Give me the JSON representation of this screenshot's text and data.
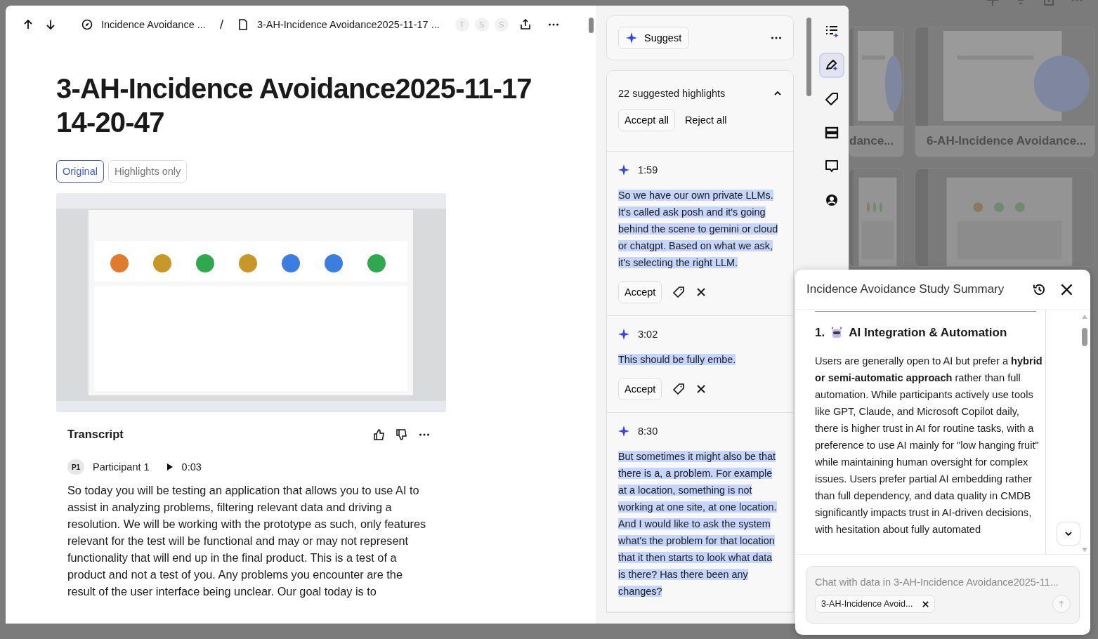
{
  "background": {
    "cards": [
      {
        "title": "dance..."
      },
      {
        "title": "6-AH-Incidence Avoidance..."
      }
    ]
  },
  "toolbar": {
    "breadcrumb": [
      {
        "kind": "project",
        "label": "Incidence Avoidance ..."
      },
      {
        "kind": "document",
        "label": "3-AH-Incidence Avoidance2025-11-17 ..."
      }
    ],
    "separator": "/",
    "avatars": [
      "T",
      "S",
      "S"
    ]
  },
  "document": {
    "title": "3-AH-Incidence Avoidance2025-11-17 14-20-47",
    "view_tabs": [
      {
        "label": "Original",
        "selected": true
      },
      {
        "label": "Highlights only",
        "selected": false
      }
    ],
    "transcript": {
      "heading": "Transcript",
      "speaker_badge": "P1",
      "speaker": "Participant 1",
      "timestamp": "0:03",
      "text": "So today you will be testing an application that allows you to use AI to assist in analyzing problems, filtering relevant data and driving a resolution. We will be working with the prototype as such, only features relevant for the test will be functional and may or may not represent functionality that will end up in the final product. This is a test of a product and not a test of you. Any problems you encounter are the result of the user interface being unclear. Our goal today is to"
    }
  },
  "suggestions": {
    "suggest_button": "Suggest",
    "count_label": "22 suggested highlights",
    "expanded": true,
    "accept_all": "Accept all",
    "reject_all": "Reject all",
    "items": [
      {
        "time": "1:59",
        "quote": "So we have our own private LLMs. It's called ask posh and it's going behind the scene to gemini or cloud or chatgpt. Based on what we ask, it's selecting the right LLM.",
        "accept": "Accept"
      },
      {
        "time": "3:02",
        "quote": "This should be fully embe.",
        "accept": "Accept"
      },
      {
        "time": "8:30",
        "quote": "But sometimes it might also be that there is a, a problem. For example at a location, something is not working at one site, at one location. And I would like to ask the system what's the problem for that location that it then starts to look what data is there? Has there been any changes?"
      }
    ]
  },
  "rail": [
    {
      "selected": false
    },
    {
      "selected": true
    },
    {
      "selected": false
    },
    {
      "selected": false
    },
    {
      "selected": false
    },
    {
      "selected": false
    }
  ],
  "summary": {
    "title": "Incidence Avoidance Study Summary",
    "section_number": "1.",
    "section_title": "AI Integration & Automation",
    "body": "Users are generally open to AI but prefer a **hybrid or semi-automatic approach** rather than full automation. While participants actively use tools like GPT, Claude, and Microsoft Copilot daily, there is higher trust in AI for routine tasks, with a preference to use AI mainly for \"low hanging fruit\" while maintaining human oversight for complex issues. Users prefer partial AI embedding rather than full dependency, and data quality in CMDB significantly impacts trust in AI-driven decisions, with hesitation about fully automated",
    "chat_placeholder": "Chat with data in 3-AH-Incidence Avoidance2025-11...",
    "chip": "3-AH-Incidence Avoid..."
  }
}
